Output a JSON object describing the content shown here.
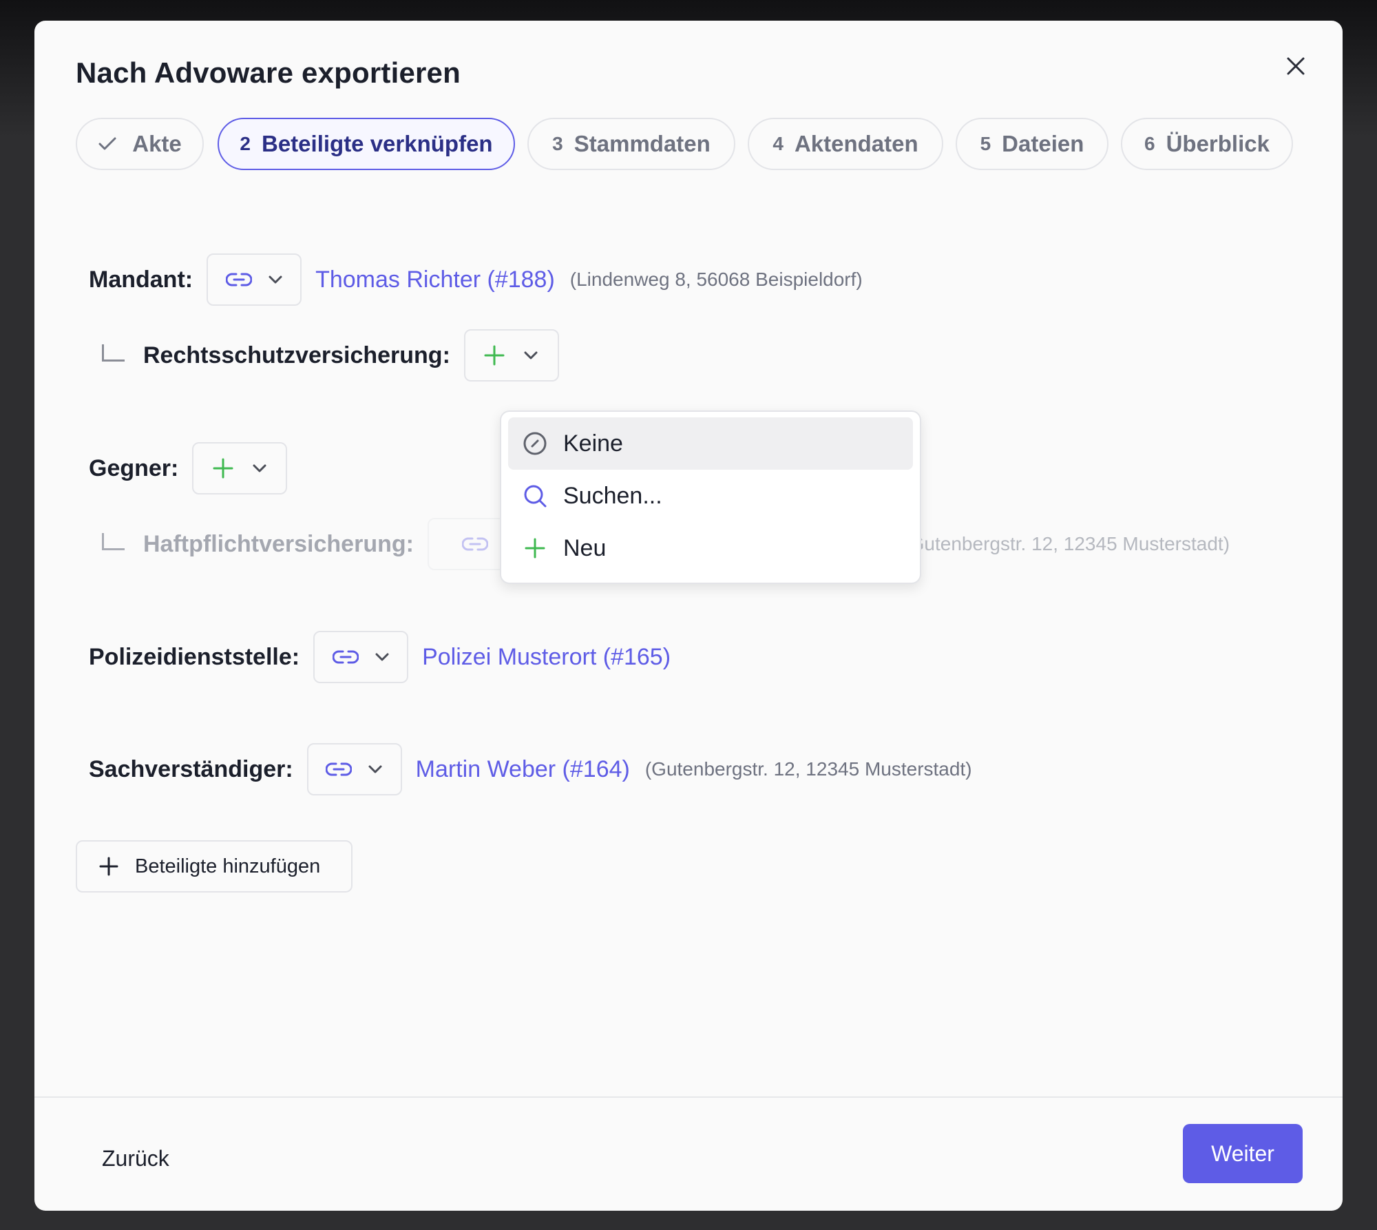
{
  "dialog": {
    "title": "Nach Advoware exportieren",
    "close_icon": "close-icon"
  },
  "steps": [
    {
      "number": "",
      "label": "Akte",
      "state": "completed",
      "icon": "check-icon"
    },
    {
      "number": "2",
      "label": "Beteiligte verknüpfen",
      "state": "active"
    },
    {
      "number": "3",
      "label": "Stammdaten",
      "state": "pending"
    },
    {
      "number": "4",
      "label": "Aktendaten",
      "state": "pending"
    },
    {
      "number": "5",
      "label": "Dateien",
      "state": "pending"
    },
    {
      "number": "6",
      "label": "Überblick",
      "state": "pending"
    }
  ],
  "participants": {
    "mandant": {
      "label": "Mandant:",
      "picker_icon": "link-icon",
      "name": "Thomas Richter (#188)",
      "address": "(Lindenweg 8, 56068 Beispieldorf)"
    },
    "rechtsschutz": {
      "label": "Rechtsschutzversicherung:",
      "picker_icon": "plus-icon"
    },
    "gegner": {
      "label": "Gegner:",
      "picker_icon": "plus-icon"
    },
    "haftpflicht": {
      "label": "Haftpflichtversicherung:",
      "picker_icon": "link-icon",
      "name_tail": ")",
      "address": "(Gutenbergstr. 12, 12345 Musterstadt)",
      "disabled": true
    },
    "polizei": {
      "label": "Polizeidienststelle:",
      "picker_icon": "link-icon",
      "name": "Polizei Musterort (#165)"
    },
    "sachverstaendiger": {
      "label": "Sachverständiger:",
      "picker_icon": "link-icon",
      "name": "Martin Weber (#164)",
      "address": "(Gutenbergstr. 12, 12345 Musterstadt)"
    }
  },
  "dropdown": {
    "items": [
      {
        "label": "Keine",
        "icon": "none-icon",
        "highlighted": true
      },
      {
        "label": "Suchen...",
        "icon": "search-icon"
      },
      {
        "label": "Neu",
        "icon": "plus-icon"
      }
    ]
  },
  "add_participants_label": "Beteiligte hinzufügen",
  "footer": {
    "back_label": "Zurück",
    "next_label": "Weiter"
  },
  "colors": {
    "accent": "#5e5ce6",
    "plus_green": "#3fb950",
    "text": "#1b1f2b",
    "muted": "#6e7280",
    "backdrop": "#2e2e30"
  }
}
